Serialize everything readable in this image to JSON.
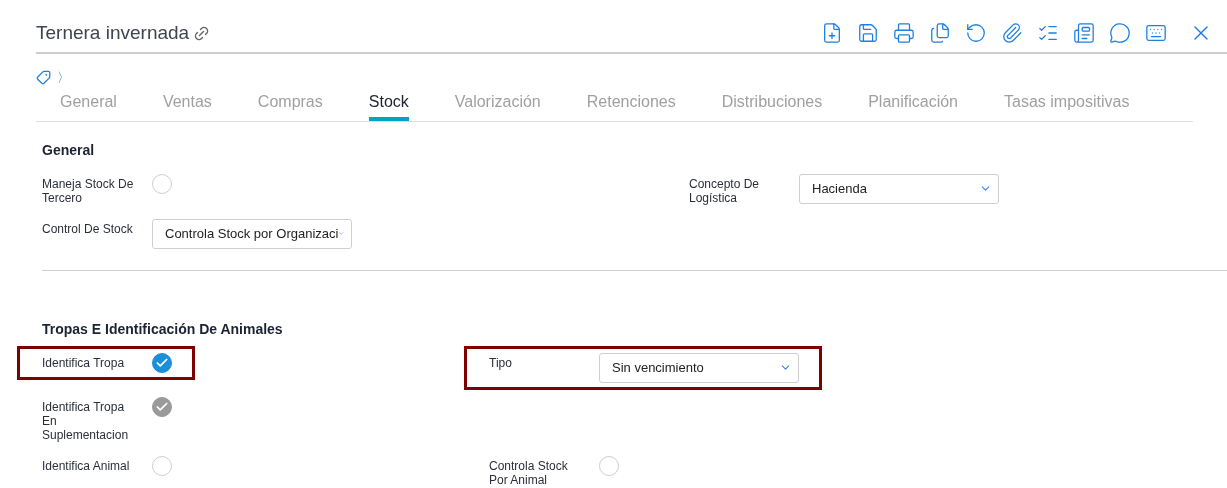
{
  "header": {
    "title": "Ternera invernada"
  },
  "breadcrumb": {
    "separator": "〉"
  },
  "tabs": [
    {
      "label": "General",
      "selected": false
    },
    {
      "label": "Ventas",
      "selected": false
    },
    {
      "label": "Compras",
      "selected": false
    },
    {
      "label": "Stock",
      "selected": true
    },
    {
      "label": "Valorización",
      "selected": false
    },
    {
      "label": "Retenciones",
      "selected": false
    },
    {
      "label": "Distribuciones",
      "selected": false
    },
    {
      "label": "Planificación",
      "selected": false
    },
    {
      "label": "Tasas impositivas",
      "selected": false
    }
  ],
  "sections": [
    {
      "title": "General",
      "rows": [
        {
          "left": {
            "label": "Maneja Stock De Tercero",
            "kind": "checkbox",
            "checked": false,
            "disabled": false,
            "highlighted": false
          },
          "right": {
            "label": "Concepto De Logística",
            "kind": "select",
            "value": "Hacienda",
            "highlighted": false
          }
        },
        {
          "left": {
            "label": "Control De Stock",
            "kind": "select",
            "value": "Controla Stock por Organizaci",
            "highlighted": false
          }
        }
      ]
    },
    {
      "title": "Tropas E Identificación De Animales",
      "rows": [
        {
          "left": {
            "label": "Identifica Tropa",
            "kind": "checkbox",
            "checked": true,
            "disabled": false,
            "highlighted": true
          },
          "right": {
            "label": "Tipo",
            "kind": "select",
            "value": "Sin vencimiento",
            "highlighted": true
          }
        },
        {
          "left": {
            "label": "Identifica Tropa En Suplementacion",
            "kind": "checkbox",
            "checked": true,
            "disabled": true,
            "highlighted": false
          }
        },
        {
          "left": {
            "label": "Identifica Animal",
            "kind": "checkbox",
            "checked": false,
            "disabled": false,
            "highlighted": false
          },
          "right": {
            "label": "Controla Stock Por Animal",
            "kind": "checkbox",
            "checked": false,
            "disabled": false,
            "highlighted": false
          }
        }
      ]
    }
  ]
}
